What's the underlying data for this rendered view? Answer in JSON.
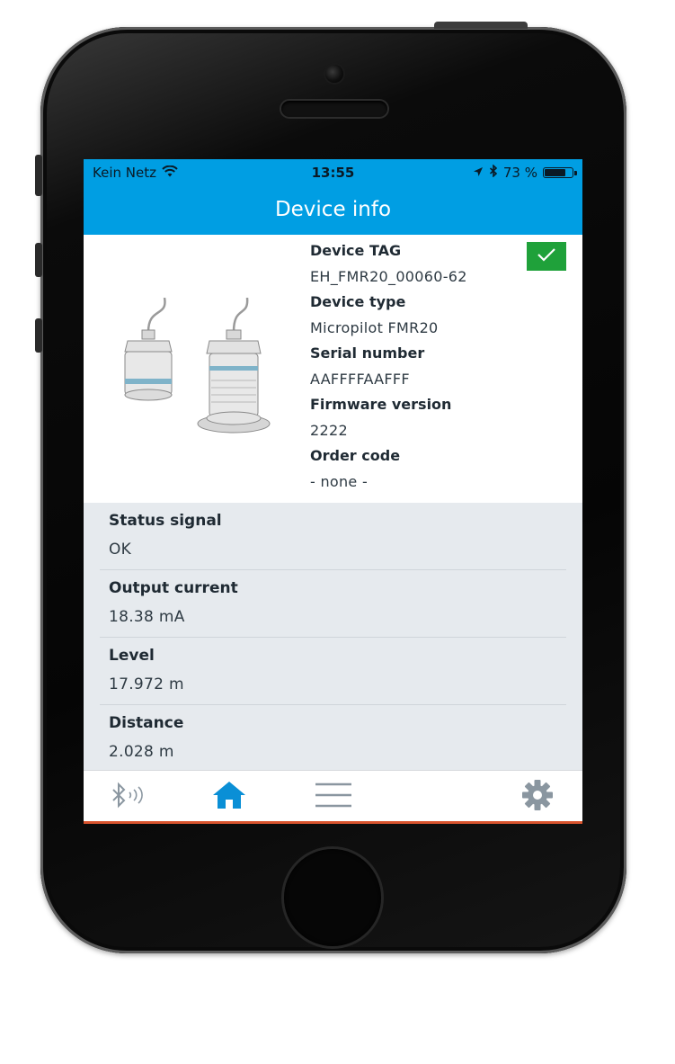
{
  "status_bar": {
    "carrier": "Kein Netz",
    "time": "13:55",
    "battery": "73 %",
    "battery_level": 0.73
  },
  "nav": {
    "title": "Device info"
  },
  "device": {
    "items": [
      {
        "label": "Device TAG",
        "value": "EH_FMR20_00060-62"
      },
      {
        "label": "Device type",
        "value": "Micropilot FMR20"
      },
      {
        "label": "Serial number",
        "value": "AAFFFFAAFFF"
      },
      {
        "label": "Firmware version",
        "value": "2222"
      },
      {
        "label": "Order code",
        "value": "- none -"
      }
    ],
    "status_color": "#1fa13a"
  },
  "measurements": [
    {
      "label": "Status signal",
      "value": "OK"
    },
    {
      "label": "Output current",
      "value": "18.38 mA"
    },
    {
      "label": "Level",
      "value": "17.972 m"
    },
    {
      "label": "Distance",
      "value": "2.028 m"
    }
  ],
  "tabbar": {
    "icons": [
      "bluetooth-icon",
      "home-icon",
      "menu-icon",
      "settings-icon"
    ],
    "active": "home-icon"
  },
  "colors": {
    "accent": "#009ee3",
    "active_tab": "#0a8fd6",
    "inactive_tab": "#8a96a0"
  }
}
